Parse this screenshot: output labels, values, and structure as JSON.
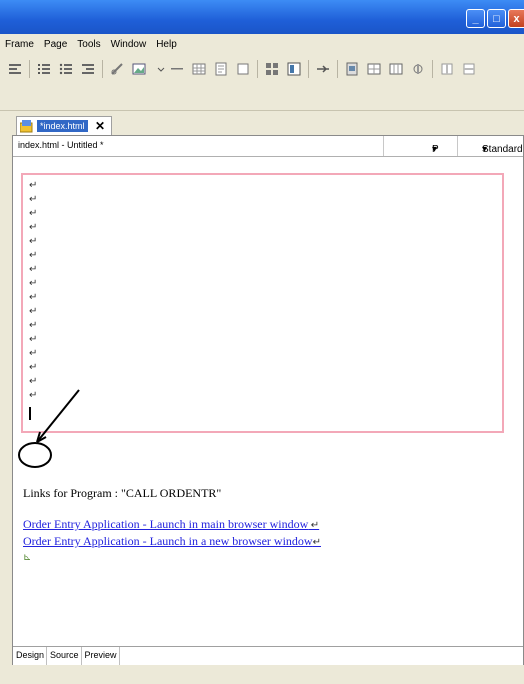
{
  "menubar": {
    "items": [
      "Frame",
      "Page",
      "Tools",
      "Window",
      "Help"
    ]
  },
  "tab": {
    "label": "*index.html",
    "close": "✕"
  },
  "pathbar": {
    "path": "index.html - Untitled *",
    "paragraph": "P",
    "style": "Standard"
  },
  "content": {
    "links_title": "Links for Program : \"CALL ORDENTR\"",
    "links": [
      "Order Entry Application - Launch in main browser window",
      "Order Entry Application - Launch in a new browser window"
    ]
  },
  "bottom_tabs": [
    "Design",
    "Source",
    "Preview"
  ]
}
